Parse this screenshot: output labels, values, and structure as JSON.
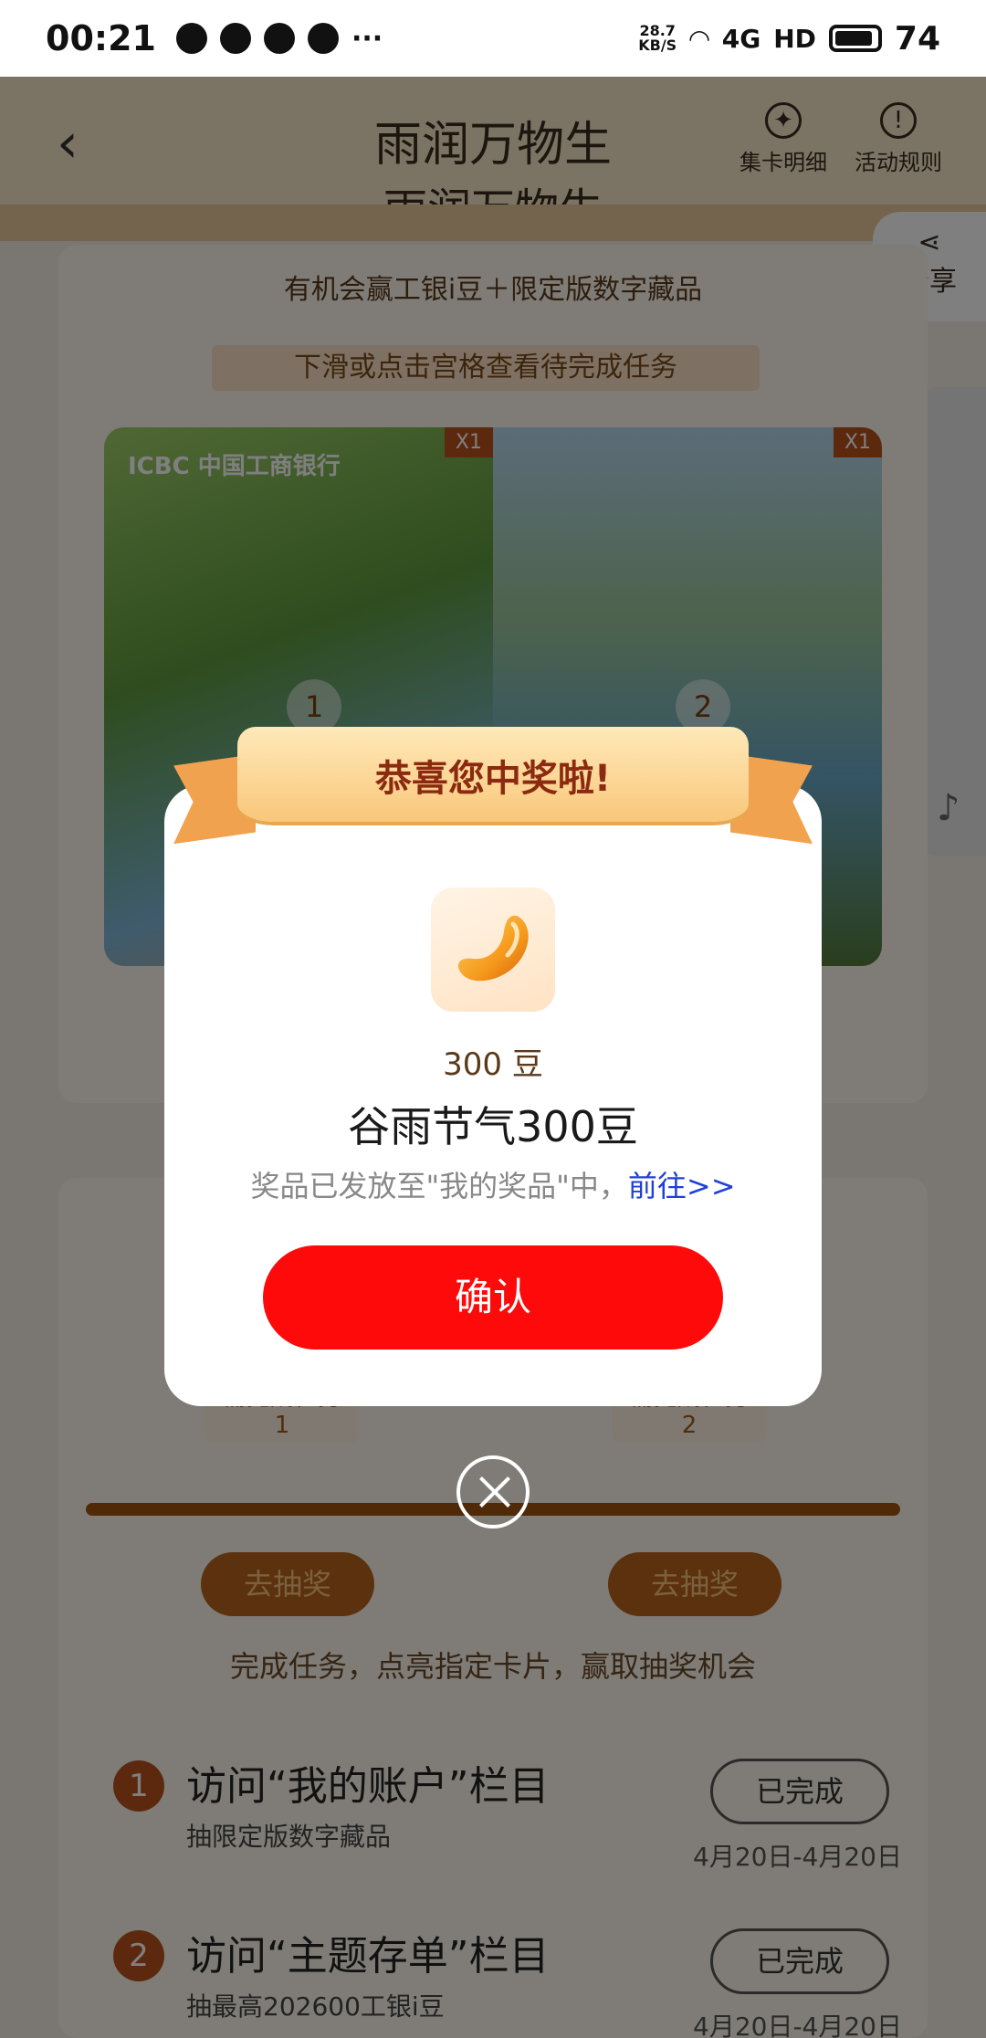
{
  "status_bar": {
    "time": "00:21",
    "speed_top": "28.7",
    "speed_bottom": "KB/S",
    "network": "4G",
    "hd": "HD",
    "battery": "74"
  },
  "header": {
    "title": "雨润万物生",
    "card_detail_label": "集卡明细",
    "rules_label": "活动规则",
    "share_label": "分享"
  },
  "page": {
    "subtitle_bg": "雨润万物生",
    "promo_text": "有机会赢工银i豆＋限定版数字藏品",
    "hint_text": "下滑或点击宫格查看待完成任务",
    "brand_text": "ICBC 中国工商银行",
    "grid": [
      {
        "badge": "X1",
        "number": "1"
      },
      {
        "badge": "X1",
        "number": "2"
      }
    ],
    "task_tags": [
      {
        "label": "需完成任务",
        "num": "1"
      },
      {
        "label": "需完成任务",
        "num": "2"
      }
    ],
    "draw_buttons": [
      "去抽奖",
      "去抽奖"
    ],
    "task_note": "完成任务，点亮指定卡片，赢取抽奖机会",
    "tasks": [
      {
        "num": "1",
        "title": "访问“我的账户”栏目",
        "subtitle": "抽限定版数字藏品",
        "status": "已完成",
        "date": "4月20日-4月20日"
      },
      {
        "num": "2",
        "title": "访问“主题存单”栏目",
        "subtitle": "抽最高202600工银i豆",
        "status": "已完成",
        "date": "4月20日-4月20日"
      }
    ]
  },
  "modal": {
    "ribbon_text": "恭喜您中奖啦!",
    "prize_small": "300 豆",
    "prize_big": "谷雨节气300豆",
    "sent_text": "奖品已发放至\"我的奖品\"中，",
    "go_link": "前往>>",
    "confirm_label": "确认"
  },
  "colors": {
    "confirm": "#ff0a0a",
    "ribbon": "#f9c77a",
    "link": "#1f3fd8"
  }
}
